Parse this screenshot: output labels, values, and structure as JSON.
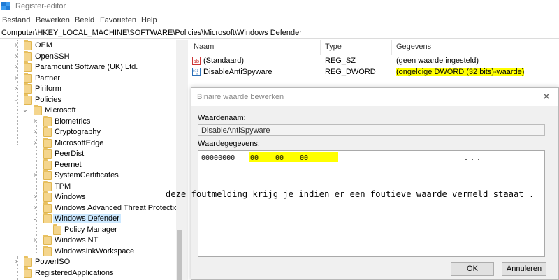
{
  "window": {
    "title": "Register-editor"
  },
  "menu": [
    "Bestand",
    "Bewerken",
    "Beeld",
    "Favorieten",
    "Help"
  ],
  "address": "Computer\\HKEY_LOCAL_MACHINE\\SOFTWARE\\Policies\\Microsoft\\Windows Defender",
  "tree": [
    {
      "label": "OEM",
      "depth": 1,
      "chev": "right"
    },
    {
      "label": "OpenSSH",
      "depth": 1,
      "chev": "right"
    },
    {
      "label": "Paramount Software (UK) Ltd.",
      "depth": 1,
      "chev": "right"
    },
    {
      "label": "Partner",
      "depth": 1,
      "chev": "right"
    },
    {
      "label": "Piriform",
      "depth": 1,
      "chev": "right"
    },
    {
      "label": "Policies",
      "depth": 1,
      "chev": "down"
    },
    {
      "label": "Microsoft",
      "depth": 2,
      "chev": "down"
    },
    {
      "label": "Biometrics",
      "depth": 3,
      "chev": "right"
    },
    {
      "label": "Cryptography",
      "depth": 3,
      "chev": "right"
    },
    {
      "label": "MicrosoftEdge",
      "depth": 3,
      "chev": "right"
    },
    {
      "label": "PeerDist",
      "depth": 3,
      "chev": "none"
    },
    {
      "label": "Peernet",
      "depth": 3,
      "chev": "none"
    },
    {
      "label": "SystemCertificates",
      "depth": 3,
      "chev": "right"
    },
    {
      "label": "TPM",
      "depth": 3,
      "chev": "none"
    },
    {
      "label": "Windows",
      "depth": 3,
      "chev": "right"
    },
    {
      "label": "Windows Advanced Threat Protection",
      "depth": 3,
      "chev": "right"
    },
    {
      "label": "Windows Defender",
      "depth": 3,
      "chev": "down",
      "selected": true
    },
    {
      "label": "Policy Manager",
      "depth": 4,
      "chev": "none"
    },
    {
      "label": "Windows NT",
      "depth": 3,
      "chev": "right"
    },
    {
      "label": "WindowsInkWorkspace",
      "depth": 3,
      "chev": "none"
    },
    {
      "label": "PowerISO",
      "depth": 1,
      "chev": "right"
    },
    {
      "label": "RegisteredApplications",
      "depth": 1,
      "chev": "none"
    }
  ],
  "columns": {
    "name": "Naam",
    "type": "Type",
    "data": "Gegevens"
  },
  "values": [
    {
      "name": "(Standaard)",
      "type": "REG_SZ",
      "data": "(geen waarde ingesteld)",
      "icon": "string-value-icon"
    },
    {
      "name": "DisableAntiSpyware",
      "type": "REG_DWORD",
      "data": "(ongeldige DWORD (32 bits)-waarde)",
      "icon": "binary-value-icon"
    }
  ],
  "dialog": {
    "title": "Binaire waarde bewerken",
    "name_label": "Waardenaam:",
    "name_value": "DisableAntiSpyware",
    "data_label": "Waardegegevens:",
    "offset": "00000000",
    "bytes": [
      "00",
      "00",
      "00"
    ],
    "ascii": "...",
    "ok": "OK",
    "cancel": "Annuleren"
  },
  "annotation": "deze foutmelding krijg je indien er een foutieve waarde vermeld staaat ."
}
